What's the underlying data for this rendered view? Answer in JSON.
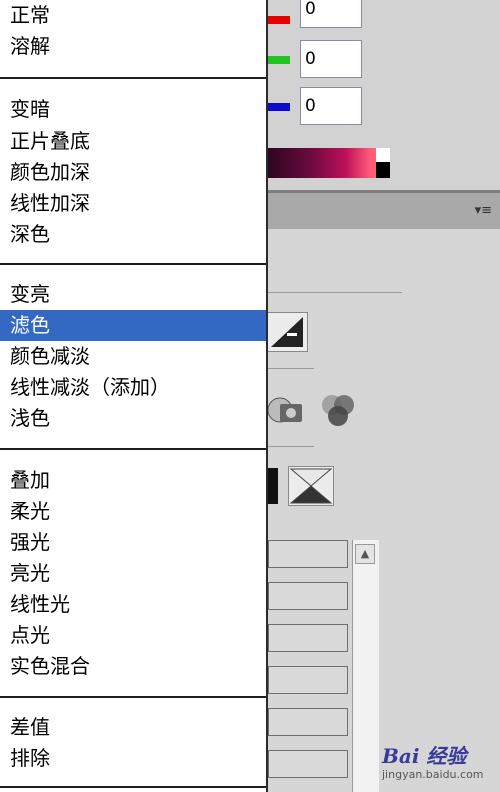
{
  "colors": {
    "red": "#e60000",
    "green": "#22c322",
    "blue": "#0a0ad2",
    "selected": "#3369c2"
  },
  "color_channels": [
    {
      "name": "red",
      "value": "0"
    },
    {
      "name": "green",
      "value": "0"
    },
    {
      "name": "blue",
      "value": "0"
    }
  ],
  "panel": {
    "menu_icon": "panel-options-icon"
  },
  "blend_menu": {
    "groups": [
      [
        "正常",
        "溶解"
      ],
      [
        "变暗",
        "正片叠底",
        "颜色加深",
        "线性加深",
        "深色"
      ],
      [
        "变亮",
        "滤色",
        "颜色减淡",
        "线性减淡（添加）",
        "浅色"
      ],
      [
        "叠加",
        "柔光",
        "强光",
        "亮光",
        "线性光",
        "点光",
        "实色混合"
      ],
      [
        "差值",
        "排除"
      ]
    ],
    "selected": "滤色"
  },
  "watermark": {
    "logo": "Bai 经验",
    "sub": "jingyan.baidu.com"
  }
}
